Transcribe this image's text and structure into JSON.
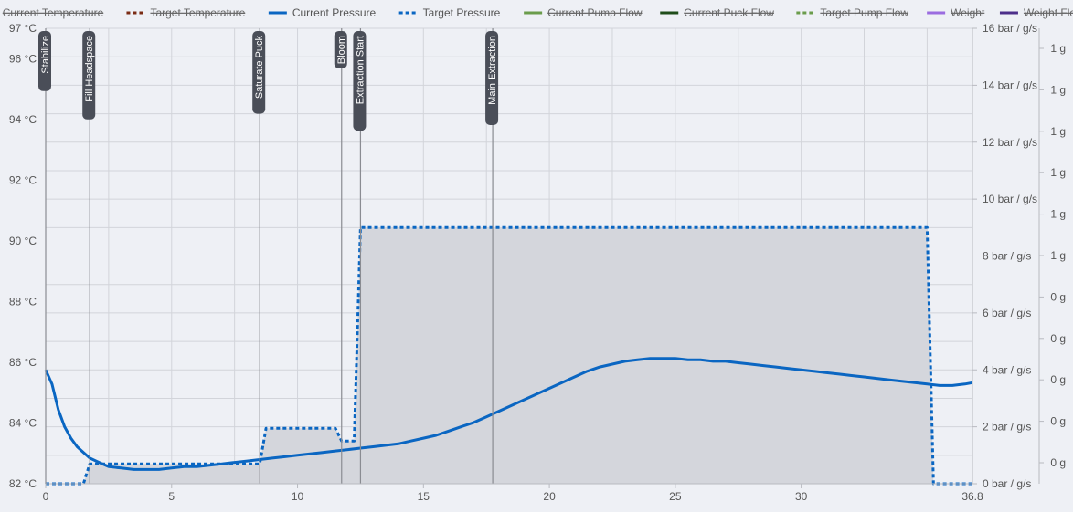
{
  "chart_data": {
    "type": "line",
    "legend": {
      "placement": "top-center",
      "items": [
        {
          "name": "Current Temperature",
          "color": "#e8663a",
          "dash": "solid",
          "hidden": true
        },
        {
          "name": "Target Temperature",
          "color": "#7a2b14",
          "dash": "dotted",
          "hidden": true
        },
        {
          "name": "Current Pressure",
          "color": "#0a66c2",
          "dash": "solid",
          "hidden": false
        },
        {
          "name": "Target Pressure",
          "color": "#0a66c2",
          "dash": "dotted",
          "hidden": false
        },
        {
          "name": "Current Pump Flow",
          "color": "#6a9c4b",
          "dash": "solid",
          "hidden": true
        },
        {
          "name": "Current Puck Flow",
          "color": "#1f4d1a",
          "dash": "solid",
          "hidden": true
        },
        {
          "name": "Target Pump Flow",
          "color": "#6a9c4b",
          "dash": "dotted",
          "hidden": true
        },
        {
          "name": "Weight",
          "color": "#9b6ce0",
          "dash": "solid",
          "hidden": true
        },
        {
          "name": "Weight Flow",
          "color": "#4d2f8a",
          "dash": "solid",
          "hidden": true
        }
      ]
    },
    "x_axis": {
      "range": [
        0,
        36.8
      ],
      "ticks": [
        0,
        5,
        10,
        15,
        20,
        25,
        30
      ],
      "tick_labels": [
        "0",
        "5",
        "10",
        "15",
        "20",
        "25",
        "30"
      ],
      "end_label": "36.8"
    },
    "y_left": {
      "range": [
        82,
        97
      ],
      "ticks": [
        82,
        84,
        86,
        88,
        90,
        92,
        94,
        96,
        97
      ],
      "tick_labels": [
        "82 °C",
        "84 °C",
        "86 °C",
        "88 °C",
        "90 °C",
        "92 °C",
        "94 °C",
        "96 °C",
        "97 °C"
      ]
    },
    "y_right": {
      "range": [
        0,
        16
      ],
      "ticks": [
        0,
        2,
        4,
        6,
        8,
        10,
        12,
        14,
        16
      ],
      "tick_labels": [
        "0 bar / g/s",
        "2 bar / g/s",
        "4 bar / g/s",
        "6 bar / g/s",
        "8 bar / g/s",
        "10 bar / g/s",
        "12 bar / g/s",
        "14 bar / g/s",
        "16 bar / g/s"
      ]
    },
    "y_weight": {
      "tick_labels": [
        "0 g",
        "0 g",
        "0 g",
        "0 g",
        "0 g",
        "1 g",
        "1 g",
        "1 g",
        "1 g",
        "1 g",
        "1 g"
      ]
    },
    "grid": true,
    "phases": [
      {
        "label": "Stabilize",
        "x": 0
      },
      {
        "label": "Fill Headspace",
        "x": 1.75
      },
      {
        "label": "Saturate Puck",
        "x": 8.5
      },
      {
        "label": "Bloom",
        "x": 11.75
      },
      {
        "label": "Extraction Start",
        "x": 12.5
      },
      {
        "label": "Main Extraction",
        "x": 17.75
      }
    ],
    "series": [
      {
        "name": "Target Pressure",
        "color": "#0a66c2",
        "dash": "dotted",
        "fill": "#d4d6dc",
        "x": [
          0,
          1.5,
          1.75,
          8.5,
          8.75,
          11.5,
          11.75,
          12.25,
          12.5,
          35.0,
          35.25,
          36.8
        ],
        "y": [
          0,
          0,
          0.7,
          0.7,
          1.95,
          1.95,
          1.5,
          1.5,
          9.0,
          9.0,
          0,
          0
        ]
      },
      {
        "name": "Current Pressure",
        "color": "#0a66c2",
        "dash": "solid",
        "x": [
          0,
          0.25,
          0.5,
          0.75,
          1.0,
          1.25,
          1.5,
          1.75,
          2.0,
          2.25,
          2.5,
          3.0,
          3.5,
          4.0,
          4.5,
          5.0,
          5.5,
          6.0,
          6.5,
          7.0,
          7.5,
          8.0,
          8.5,
          9.0,
          9.5,
          10.0,
          10.5,
          11.0,
          11.5,
          12.0,
          12.5,
          13.0,
          13.5,
          14.0,
          14.5,
          15.0,
          15.5,
          16.0,
          16.5,
          17.0,
          17.5,
          18.0,
          18.5,
          19.0,
          19.5,
          20.0,
          20.5,
          21.0,
          21.5,
          22.0,
          22.5,
          23.0,
          23.5,
          24.0,
          24.5,
          25.0,
          25.5,
          26.0,
          26.5,
          27.0,
          27.5,
          28.0,
          28.5,
          29.0,
          29.5,
          30.0,
          30.5,
          31.0,
          31.5,
          32.0,
          32.5,
          33.0,
          33.5,
          34.0,
          34.5,
          35.0,
          35.5,
          36.0,
          36.5,
          36.8
        ],
        "y": [
          4.0,
          3.5,
          2.6,
          2.0,
          1.6,
          1.3,
          1.1,
          0.9,
          0.8,
          0.7,
          0.6,
          0.55,
          0.5,
          0.5,
          0.5,
          0.55,
          0.6,
          0.6,
          0.65,
          0.7,
          0.75,
          0.8,
          0.85,
          0.9,
          0.95,
          1.0,
          1.05,
          1.1,
          1.15,
          1.2,
          1.25,
          1.3,
          1.35,
          1.4,
          1.5,
          1.6,
          1.7,
          1.85,
          2.0,
          2.15,
          2.35,
          2.55,
          2.75,
          2.95,
          3.15,
          3.35,
          3.55,
          3.75,
          3.95,
          4.1,
          4.2,
          4.3,
          4.35,
          4.4,
          4.4,
          4.4,
          4.35,
          4.35,
          4.3,
          4.3,
          4.25,
          4.2,
          4.15,
          4.1,
          4.05,
          4.0,
          3.95,
          3.9,
          3.85,
          3.8,
          3.75,
          3.7,
          3.65,
          3.6,
          3.55,
          3.5,
          3.45,
          3.45,
          3.5,
          3.55
        ]
      }
    ]
  },
  "colors": {
    "background": "#eef0f5",
    "grid": "#d2d4da",
    "axis": "#b8bac0",
    "phase_line": "#8a8c92",
    "phase_label_bg": "#4a4e58"
  }
}
